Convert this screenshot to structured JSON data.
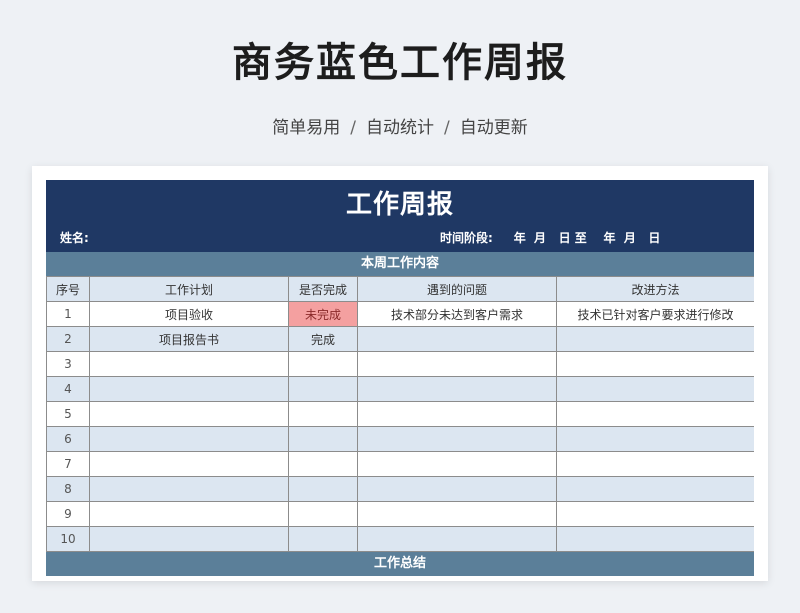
{
  "page": {
    "title": "商务蓝色工作周报",
    "subtitle_parts": [
      "简单易用",
      "自动统计",
      "自动更新"
    ],
    "separator": "/"
  },
  "sheet": {
    "title": "工作周报",
    "name_label": "姓名:",
    "period_label": "时间阶段:",
    "period_text": "年  月   日 至    年  月   日",
    "section_content": "本周工作内容",
    "section_summary": "工作总结",
    "columns": [
      "序号",
      "工作计划",
      "是否完成",
      "遇到的问题",
      "改进方法"
    ],
    "rows": [
      {
        "no": "1",
        "plan": "项目验收",
        "done": "未完成",
        "problem": "技术部分未达到客户需求",
        "fix": "技术已针对客户要求进行修改"
      },
      {
        "no": "2",
        "plan": "项目报告书",
        "done": "完成",
        "problem": "",
        "fix": ""
      },
      {
        "no": "3",
        "plan": "",
        "done": "",
        "problem": "",
        "fix": ""
      },
      {
        "no": "4",
        "plan": "",
        "done": "",
        "problem": "",
        "fix": ""
      },
      {
        "no": "5",
        "plan": "",
        "done": "",
        "problem": "",
        "fix": ""
      },
      {
        "no": "6",
        "plan": "",
        "done": "",
        "problem": "",
        "fix": ""
      },
      {
        "no": "7",
        "plan": "",
        "done": "",
        "problem": "",
        "fix": ""
      },
      {
        "no": "8",
        "plan": "",
        "done": "",
        "problem": "",
        "fix": ""
      },
      {
        "no": "9",
        "plan": "",
        "done": "",
        "problem": "",
        "fix": ""
      },
      {
        "no": "10",
        "plan": "",
        "done": "",
        "problem": "",
        "fix": ""
      }
    ]
  },
  "colors": {
    "header_navy": "#1f3864",
    "section_blue": "#5b7f99",
    "row_light_blue": "#dce6f1",
    "incomplete_red": "#f4a0a0"
  }
}
